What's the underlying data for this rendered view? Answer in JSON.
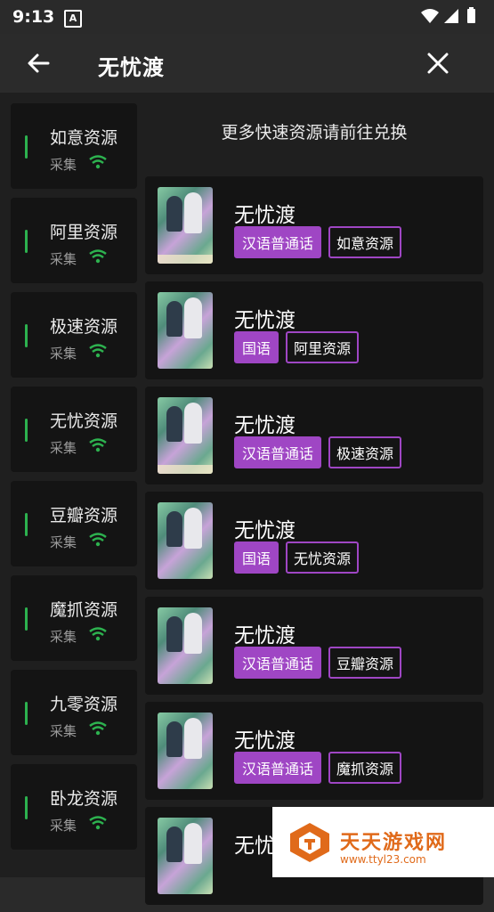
{
  "status": {
    "time": "9:13",
    "app_icon": "A"
  },
  "header": {
    "title": "无忧渡"
  },
  "sidebar": {
    "items": [
      {
        "label": "如意资源",
        "sub": "采集"
      },
      {
        "label": "阿里资源",
        "sub": "采集"
      },
      {
        "label": "极速资源",
        "sub": "采集"
      },
      {
        "label": "无忧资源",
        "sub": "采集"
      },
      {
        "label": "豆瓣资源",
        "sub": "采集"
      },
      {
        "label": "魔抓资源",
        "sub": "采集"
      },
      {
        "label": "九零资源",
        "sub": "采集"
      },
      {
        "label": "卧龙资源",
        "sub": "采集"
      }
    ]
  },
  "main": {
    "hint": "更多快速资源请前往兑换",
    "results": [
      {
        "title": "无忧渡",
        "lang": "汉语普通话",
        "source": "如意资源"
      },
      {
        "title": "无忧渡",
        "lang": "国语",
        "source": "阿里资源"
      },
      {
        "title": "无忧渡",
        "lang": "汉语普通话",
        "source": "极速资源"
      },
      {
        "title": "无忧渡",
        "lang": "国语",
        "source": "无忧资源"
      },
      {
        "title": "无忧渡",
        "lang": "汉语普通话",
        "source": "豆瓣资源"
      },
      {
        "title": "无忧渡",
        "lang": "汉语普通话",
        "source": "魔抓资源"
      },
      {
        "title": "无忧渡",
        "lang": "",
        "source": ""
      }
    ]
  },
  "watermark": {
    "title": "天天游戏网",
    "url": "www.ttyl23.com"
  },
  "colors": {
    "accent": "#9f46c4",
    "signal": "#2db24f"
  }
}
